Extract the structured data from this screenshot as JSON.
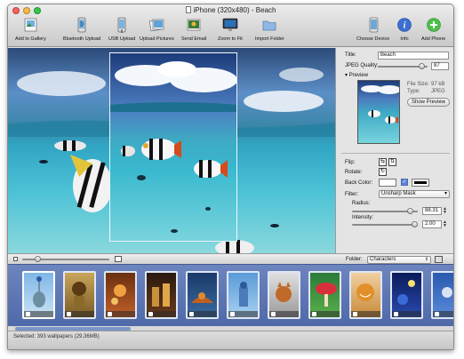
{
  "window": {
    "title": "iPhone (320x480) - Beach"
  },
  "toolbar": {
    "add_to_gallery": "Add to Gallery",
    "bluetooth_upload": "Bluetooth Upload",
    "usb_upload": "USB Upload",
    "upload_pictures": "Upload Pictures",
    "send_email": "Send Email",
    "zoom_to_fit": "Zoom to Fit",
    "import_folder": "Import Folder",
    "choose_device": "Choose Device",
    "info": "Info",
    "add_phone": "Add Phone"
  },
  "panel": {
    "title_label": "Title:",
    "title_value": "Beach",
    "jpeg_quality_label": "JPEG Quality:",
    "jpeg_quality_value": "87",
    "jpeg_quality_fraction": 0.87,
    "preview_label": "Preview",
    "file_size_label": "File Size:",
    "file_size_value": "97 kB",
    "type_label": "Type:",
    "type_value": "JPEG",
    "show_preview": "Show Preview",
    "flip_label": "Flip:",
    "rotate_label": "Rotate:",
    "back_color_label": "Back Color:",
    "back_color_a": "#ffffff",
    "back_color_b": "#000000",
    "filter_label": "Filter:",
    "filter_value": "Unsharp Mask",
    "radius_label": "Radius:",
    "radius_value": "88.31",
    "intensity_label": "Intensity:",
    "intensity_value": "2.00"
  },
  "strip": {
    "folder_label": "Folder:",
    "folder_value": "Characters",
    "thumbnails": [
      "",
      "",
      "",
      "",
      "",
      "",
      "",
      "",
      "",
      "",
      "",
      ""
    ]
  },
  "status": {
    "text": "Selected: 393 wallpapers (29.36MB)"
  },
  "colors": {
    "accent": "#4a6bb0",
    "close": "#fc615d",
    "minimize": "#fdbc40",
    "zoom": "#34c84a"
  }
}
